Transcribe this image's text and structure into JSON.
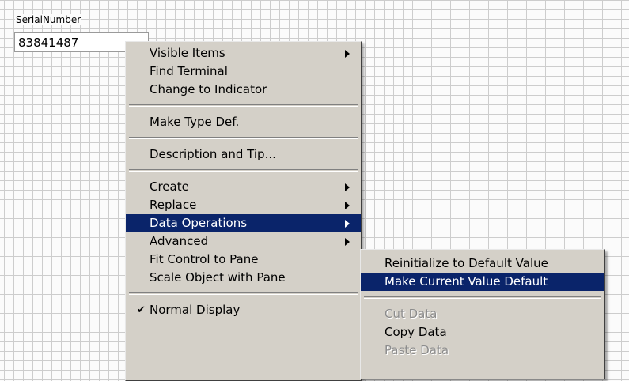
{
  "control": {
    "label": "SerialNumber",
    "value": "83841487"
  },
  "context_menu": {
    "group1": [
      "Visible Items",
      "Find Terminal",
      "Change to Indicator"
    ],
    "group2": [
      "Make Type Def."
    ],
    "group3": [
      "Description and Tip..."
    ],
    "group4": [
      "Create",
      "Replace",
      "Data Operations",
      "Advanced",
      "Fit Control to Pane",
      "Scale Object with Pane"
    ],
    "group5": [
      "Normal Display"
    ]
  },
  "submenu": {
    "group1": [
      "Reinitialize to Default Value",
      "Make Current Value Default"
    ],
    "group2": [
      "Cut Data",
      "Copy Data",
      "Paste Data"
    ]
  },
  "colors": {
    "highlight": "#0a246a",
    "menu_bg": "#d4d0c8",
    "grid_line": "#cdcdcd"
  }
}
